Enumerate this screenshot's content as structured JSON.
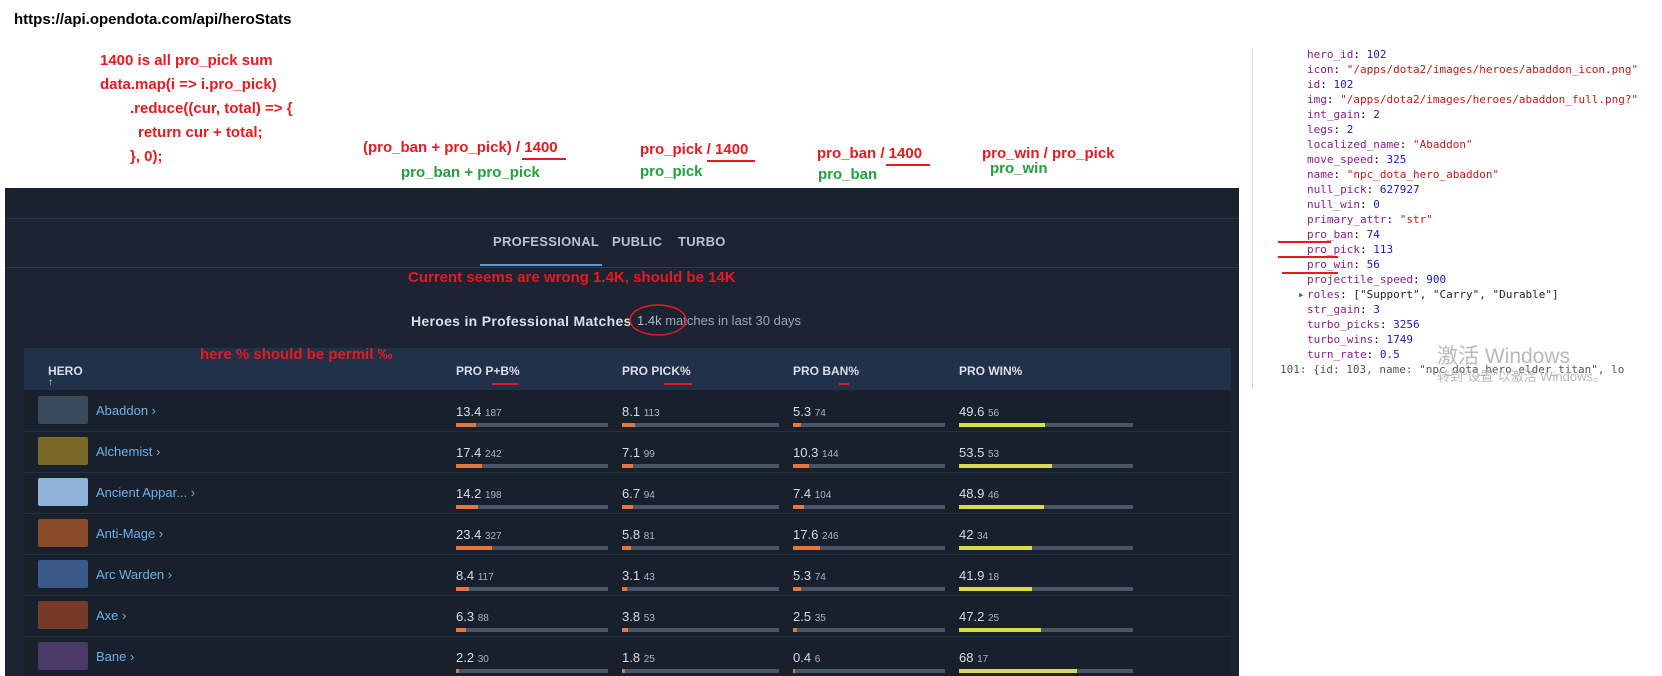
{
  "url": "https://api.opendota.com/api/heroStats",
  "annotation_code": [
    "1400 is all pro_pick sum",
    "data.map(i => i.pro_pick)",
    "  .reduce((cur, total) => {",
    "    return cur + total;",
    "  }, 0);"
  ],
  "annotations": {
    "pb_formula": "(pro_ban + pro_pick) / 1400",
    "pb_field": "pro_ban + pro_pick",
    "pick_formula": "pro_pick / 1400",
    "pick_field": "pro_pick",
    "ban_formula": "pro_ban / 1400",
    "ban_field": "pro_ban",
    "win_formula": "pro_win  / pro_pick",
    "win_field": "pro_win",
    "wrong_note": "Current seems are wrong 1.4K, should be 14K",
    "permil_note": "here % should be permil ‰"
  },
  "tabs": [
    {
      "label": "PROFESSIONAL",
      "active": true
    },
    {
      "label": "PUBLIC",
      "active": false
    },
    {
      "label": "TURBO",
      "active": false
    }
  ],
  "heroes_title": "Heroes in Professional Matches",
  "heroes_count": "1.4k",
  "heroes_count_suffix": "matches in last 30 days",
  "columns": {
    "hero": "HERO",
    "sort_arrow": "↑",
    "pro_pb": "PRO P+B%",
    "pro_pick": "PRO PICK%",
    "pro_ban": "PRO BAN%",
    "pro_win": "PRO WIN%"
  },
  "colors": {
    "orange_bar": "#e8753a",
    "yellow_bar": "#d9dc4a",
    "link": "#6fb0ea"
  },
  "rows": [
    {
      "name": "Abaddon",
      "img": "#3a4a5c",
      "pb": "13.4",
      "pb_n": "187",
      "pick": "8.1",
      "pick_n": "113",
      "ban": "5.3",
      "ban_n": "74",
      "win": "49.6",
      "win_n": "56"
    },
    {
      "name": "Alchemist",
      "img": "#7a6a2a",
      "pb": "17.4",
      "pb_n": "242",
      "pick": "7.1",
      "pick_n": "99",
      "ban": "10.3",
      "ban_n": "144",
      "win": "53.5",
      "win_n": "53"
    },
    {
      "name": "Ancient Appar...",
      "img": "#8fb2d9",
      "pb": "14.2",
      "pb_n": "198",
      "pick": "6.7",
      "pick_n": "94",
      "ban": "7.4",
      "ban_n": "104",
      "win": "48.9",
      "win_n": "46"
    },
    {
      "name": "Anti-Mage",
      "img": "#8a4a2a",
      "pb": "23.4",
      "pb_n": "327",
      "pick": "5.8",
      "pick_n": "81",
      "ban": "17.6",
      "ban_n": "246",
      "win": "42",
      "win_n": "34"
    },
    {
      "name": "Arc Warden",
      "img": "#3a5a8a",
      "pb": "8.4",
      "pb_n": "117",
      "pick": "3.1",
      "pick_n": "43",
      "ban": "5.3",
      "ban_n": "74",
      "win": "41.9",
      "win_n": "18"
    },
    {
      "name": "Axe",
      "img": "#7a3a2a",
      "pb": "6.3",
      "pb_n": "88",
      "pick": "3.8",
      "pick_n": "53",
      "ban": "2.5",
      "ban_n": "35",
      "win": "47.2",
      "win_n": "25"
    },
    {
      "name": "Bane",
      "img": "#4a3a6a",
      "pb": "2.2",
      "pb_n": "30",
      "pick": "1.8",
      "pick_n": "25",
      "ban": "0.4",
      "ban_n": "6",
      "win": "68",
      "win_n": "17"
    }
  ],
  "devtools": [
    {
      "k": "hero_id",
      "v": "102",
      "t": "num"
    },
    {
      "k": "icon",
      "v": "\"/apps/dota2/images/heroes/abaddon_icon.png\"",
      "t": "str"
    },
    {
      "k": "id",
      "v": "102",
      "t": "num"
    },
    {
      "k": "img",
      "v": "\"/apps/dota2/images/heroes/abaddon_full.png?\"",
      "t": "str"
    },
    {
      "k": "int_gain",
      "v": "2",
      "t": "num"
    },
    {
      "k": "legs",
      "v": "2",
      "t": "num"
    },
    {
      "k": "localized_name",
      "v": "\"Abaddon\"",
      "t": "str"
    },
    {
      "k": "move_speed",
      "v": "325",
      "t": "num"
    },
    {
      "k": "name",
      "v": "\"npc_dota_hero_abaddon\"",
      "t": "str"
    },
    {
      "k": "null_pick",
      "v": "627927",
      "t": "num"
    },
    {
      "k": "null_win",
      "v": "0",
      "t": "num"
    },
    {
      "k": "primary_attr",
      "v": "\"str\"",
      "t": "str"
    },
    {
      "k": "pro_ban",
      "v": "74",
      "t": "num"
    },
    {
      "k": "pro_pick",
      "v": "113",
      "t": "num"
    },
    {
      "k": "pro_win",
      "v": "56",
      "t": "num"
    },
    {
      "k": "projectile_speed",
      "v": "900",
      "t": "num"
    },
    {
      "k": "roles",
      "v": "[\"Support\", \"Carry\", \"Durable\"]",
      "t": "arr"
    },
    {
      "k": "str_gain",
      "v": "3",
      "t": "num"
    },
    {
      "k": "turbo_picks",
      "v": "3256",
      "t": "num"
    },
    {
      "k": "turbo_wins",
      "v": "1749",
      "t": "num"
    },
    {
      "k": "turn_rate",
      "v": "0.5",
      "t": "num"
    }
  ],
  "devtools_last": "101: {id: 103, name: \"npc_dota_hero_elder_titan\", lo",
  "watermark": {
    "line1": "激活 Windows",
    "line2": "转到“设置”以激活 Windows。"
  }
}
